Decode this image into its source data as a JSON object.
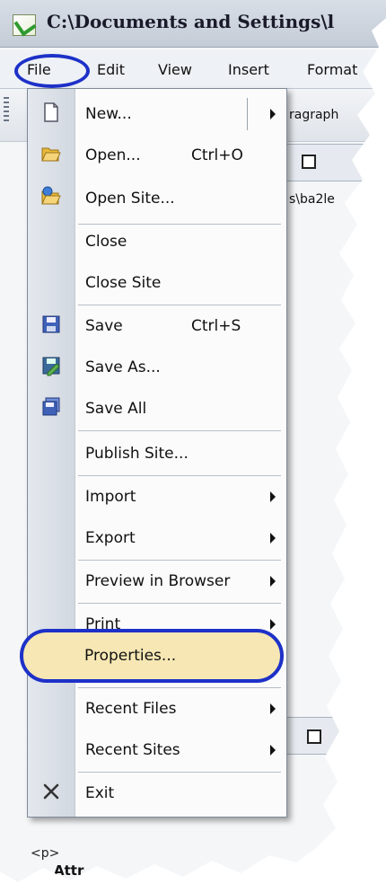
{
  "window": {
    "title": "C:\\Documents and Settings\\l"
  },
  "menubar": {
    "items": [
      "File",
      "Edit",
      "View",
      "Insert",
      "Format"
    ]
  },
  "background": {
    "toolbar_snippet": "ragraph",
    "path_snippet": "s\\ba2le",
    "tag": "<p>",
    "attr_label": "Attr"
  },
  "file_menu": {
    "items": [
      {
        "label": "New...",
        "shortcut": "",
        "submenu": true,
        "icon": "new-document-icon"
      },
      {
        "label": "Open...",
        "shortcut": "Ctrl+O",
        "submenu": false,
        "icon": "open-folder-icon"
      },
      {
        "label": "Open Site...",
        "shortcut": "",
        "submenu": false,
        "icon": "open-site-icon"
      },
      {
        "label": "Close",
        "shortcut": "",
        "submenu": false,
        "icon": ""
      },
      {
        "label": "Close Site",
        "shortcut": "",
        "submenu": false,
        "icon": ""
      },
      {
        "label": "Save",
        "shortcut": "Ctrl+S",
        "submenu": false,
        "icon": "save-icon"
      },
      {
        "label": "Save As...",
        "shortcut": "",
        "submenu": false,
        "icon": "save-as-icon"
      },
      {
        "label": "Save All",
        "shortcut": "",
        "submenu": false,
        "icon": "save-all-icon"
      },
      {
        "label": "Publish Site...",
        "shortcut": "",
        "submenu": false,
        "icon": ""
      },
      {
        "label": "Import",
        "shortcut": "",
        "submenu": true,
        "icon": ""
      },
      {
        "label": "Export",
        "shortcut": "",
        "submenu": true,
        "icon": ""
      },
      {
        "label": "Preview in Browser",
        "shortcut": "",
        "submenu": true,
        "icon": ""
      },
      {
        "label": "Print",
        "shortcut": "",
        "submenu": true,
        "icon": ""
      },
      {
        "label": "Properties...",
        "shortcut": "",
        "submenu": false,
        "icon": "",
        "highlighted": true
      },
      {
        "label": "Recent Files",
        "shortcut": "",
        "submenu": true,
        "icon": ""
      },
      {
        "label": "Recent Sites",
        "shortcut": "",
        "submenu": true,
        "icon": ""
      },
      {
        "label": "Exit",
        "shortcut": "",
        "submenu": false,
        "icon": "close-x-icon"
      }
    ]
  },
  "colors": {
    "annotation_blue": "#1d31c8",
    "highlight_fill": "#f6e7b4"
  }
}
